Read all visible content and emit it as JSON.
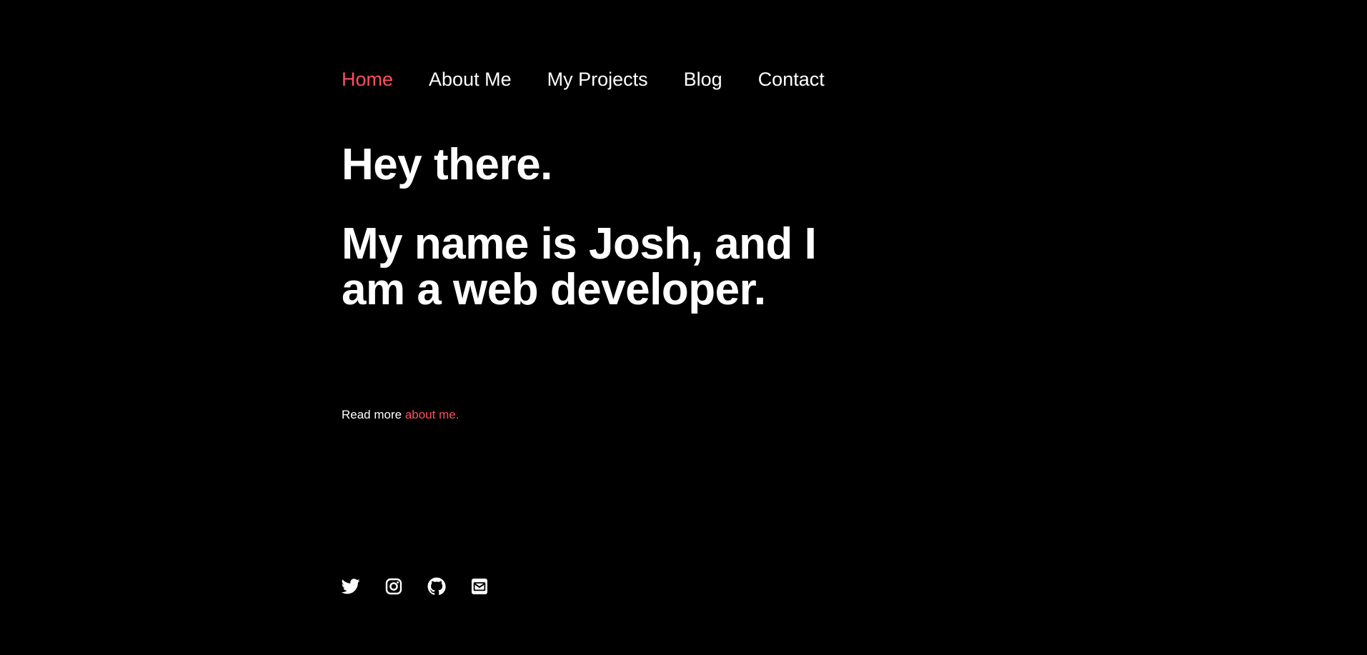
{
  "nav": {
    "items": [
      {
        "label": "Home",
        "active": true
      },
      {
        "label": "About Me",
        "active": false
      },
      {
        "label": "My Projects",
        "active": false
      },
      {
        "label": "Blog",
        "active": false
      },
      {
        "label": "Contact",
        "active": false
      }
    ]
  },
  "hero": {
    "greeting": "Hey there.",
    "intro": "My name is Josh, and I am a web developer."
  },
  "read_more": {
    "prefix": "Read more ",
    "link_label": "about me."
  },
  "socials": [
    {
      "icon": "twitter-icon"
    },
    {
      "icon": "instagram-icon"
    },
    {
      "icon": "github-icon"
    },
    {
      "icon": "email-icon"
    }
  ],
  "colors": {
    "background": "#000000",
    "text": "#ffffff",
    "accent": "#ff4f5e"
  }
}
